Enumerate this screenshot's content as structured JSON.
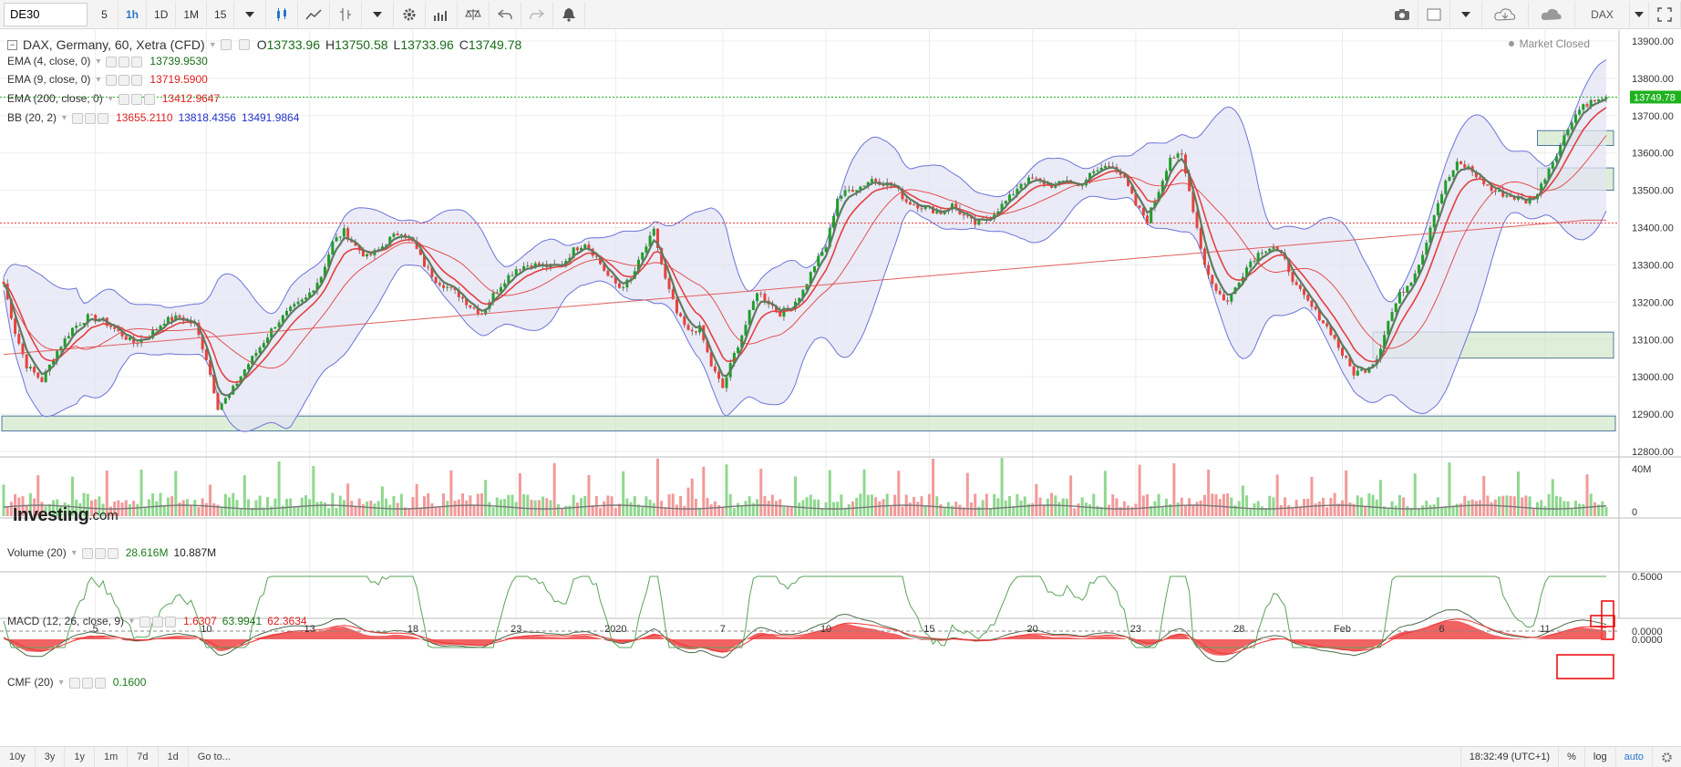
{
  "toolbar": {
    "symbol": "DE30",
    "intervals": [
      "5",
      "1h",
      "1D",
      "1M",
      "15"
    ],
    "active_interval": "1h",
    "right_symbol": "DAX",
    "icons": [
      "chart-type-icon",
      "line-icon",
      "bar-style-icon",
      "settings-icon",
      "indicators-icon",
      "compare-icon",
      "undo-icon",
      "redo-icon",
      "alert-icon",
      "camera-icon",
      "layout-icon",
      "cloud-load-icon",
      "cloud-save-icon",
      "fullscreen-icon"
    ]
  },
  "main_legend": {
    "title": "DAX, Germany, 60, Xetra (CFD)",
    "o_label": "O",
    "o": "13733.96",
    "h_label": "H",
    "h": "13750.58",
    "l_label": "L",
    "l": "13733.96",
    "c_label": "C",
    "c": "13749.78",
    "market_status": "Market Closed"
  },
  "indicators": [
    {
      "label": "EMA (4, close, 0)",
      "values": [
        "13739.9530"
      ],
      "colors": [
        "#1a7a1a"
      ]
    },
    {
      "label": "EMA (9, close, 0)",
      "values": [
        "13719.5900"
      ],
      "colors": [
        "#e02020"
      ]
    },
    {
      "label": "EMA (200, close, 0)",
      "values": [
        "13412.9647"
      ],
      "colors": [
        "#e02020"
      ]
    },
    {
      "label": "BB (20, 2)",
      "values": [
        "13655.2110",
        "13818.4356",
        "13491.9864"
      ],
      "colors": [
        "#e02020",
        "#2233cc",
        "#2233cc"
      ]
    }
  ],
  "volume_legend": {
    "label": "Volume (20)",
    "v1": "28.616M",
    "v2": "10.887M"
  },
  "macd_legend": {
    "label": "MACD (12, 26, close, 9)",
    "v1": "1.6307",
    "v2": "63.9941",
    "v3": "62.3634"
  },
  "cmf_legend": {
    "label": "CMF (20)",
    "v1": "0.1600"
  },
  "watermark": {
    "brand": "Investing",
    "suffix": ".com"
  },
  "price_axis": {
    "ticks": [
      "13900.00",
      "13800.00",
      "13700.00",
      "13600.00",
      "13500.00",
      "13400.00",
      "13300.00",
      "13200.00",
      "13100.00",
      "13000.00",
      "12900.00",
      "12800.00"
    ],
    "last_price": "13749.78"
  },
  "volume_axis": {
    "ticks": [
      "40M",
      "0"
    ]
  },
  "macd_axis": {
    "ticks": [
      "0.0000"
    ]
  },
  "cmf_axis": {
    "ticks": [
      "0.5000",
      "0.0000"
    ]
  },
  "x_axis": {
    "labels": [
      "5",
      "10",
      "13",
      "18",
      "23",
      "2020",
      "7",
      "10",
      "15",
      "20",
      "23",
      "28",
      "Feb",
      "6",
      "11"
    ]
  },
  "bottom_bar": {
    "ranges": [
      "10y",
      "3y",
      "1y",
      "1m",
      "7d",
      "1d"
    ],
    "goto": "Go to...",
    "time": "18:32:49 (UTC+1)",
    "pct": "%",
    "log": "log",
    "auto": "auto"
  },
  "colors": {
    "up": "#1e9e2a",
    "down": "#e8413c",
    "bb": "#6b74d9",
    "bb_fill": "#e3e4f3",
    "ema4": "#5e7a5e",
    "ema9": "#e34040",
    "ema200": "#e06060",
    "zone": "#c8e3c0",
    "accent": "#2a77c9"
  },
  "chart_data": {
    "type": "candlestick",
    "title": "DAX, Germany, 60, Xetra (CFD)",
    "x_labels": [
      "5",
      "10",
      "13",
      "18",
      "23",
      "2020",
      "7",
      "10",
      "15",
      "20",
      "23",
      "28",
      "Feb",
      "6",
      "11"
    ],
    "ylim": [
      12800,
      13900
    ],
    "close_path": [
      [
        0,
        13250
      ],
      [
        3,
        13120
      ],
      [
        6,
        13030
      ],
      [
        10,
        12990
      ],
      [
        14,
        13070
      ],
      [
        18,
        13130
      ],
      [
        22,
        13160
      ],
      [
        26,
        13150
      ],
      [
        30,
        13120
      ],
      [
        34,
        13090
      ],
      [
        38,
        13110
      ],
      [
        42,
        13150
      ],
      [
        46,
        13160
      ],
      [
        50,
        13140
      ],
      [
        53,
        13050
      ],
      [
        56,
        12920
      ],
      [
        59,
        12950
      ],
      [
        63,
        13020
      ],
      [
        67,
        13080
      ],
      [
        71,
        13140
      ],
      [
        75,
        13180
      ],
      [
        79,
        13210
      ],
      [
        83,
        13270
      ],
      [
        86,
        13360
      ],
      [
        89,
        13390
      ],
      [
        92,
        13350
      ],
      [
        95,
        13320
      ],
      [
        98,
        13340
      ],
      [
        101,
        13370
      ],
      [
        104,
        13390
      ],
      [
        107,
        13360
      ],
      [
        110,
        13300
      ],
      [
        113,
        13260
      ],
      [
        116,
        13240
      ],
      [
        119,
        13220
      ],
      [
        122,
        13190
      ],
      [
        125,
        13170
      ],
      [
        128,
        13220
      ],
      [
        131,
        13260
      ],
      [
        134,
        13290
      ],
      [
        137,
        13300
      ],
      [
        140,
        13300
      ],
      [
        143,
        13295
      ],
      [
        146,
        13300
      ],
      [
        149,
        13340
      ],
      [
        152,
        13360
      ],
      [
        155,
        13320
      ],
      [
        158,
        13270
      ],
      [
        161,
        13240
      ],
      [
        164,
        13260
      ],
      [
        167,
        13330
      ],
      [
        170,
        13390
      ],
      [
        173,
        13260
      ],
      [
        176,
        13170
      ],
      [
        179,
        13120
      ],
      [
        182,
        13130
      ],
      [
        185,
        13030
      ],
      [
        188,
        12970
      ],
      [
        191,
        13060
      ],
      [
        194,
        13140
      ],
      [
        197,
        13230
      ],
      [
        200,
        13200
      ],
      [
        203,
        13170
      ],
      [
        206,
        13190
      ],
      [
        209,
        13230
      ],
      [
        212,
        13300
      ],
      [
        215,
        13350
      ],
      [
        218,
        13480
      ],
      [
        221,
        13500
      ],
      [
        224,
        13510
      ],
      [
        227,
        13530
      ],
      [
        230,
        13520
      ],
      [
        233,
        13510
      ],
      [
        236,
        13470
      ],
      [
        239,
        13460
      ],
      [
        242,
        13450
      ],
      [
        245,
        13440
      ],
      [
        248,
        13460
      ],
      [
        251,
        13430
      ],
      [
        254,
        13410
      ],
      [
        257,
        13420
      ],
      [
        260,
        13450
      ],
      [
        263,
        13480
      ],
      [
        266,
        13520
      ],
      [
        269,
        13530
      ],
      [
        272,
        13520
      ],
      [
        275,
        13510
      ],
      [
        278,
        13530
      ],
      [
        281,
        13510
      ],
      [
        284,
        13540
      ],
      [
        287,
        13560
      ],
      [
        290,
        13570
      ],
      [
        293,
        13530
      ],
      [
        296,
        13460
      ],
      [
        299,
        13420
      ],
      [
        302,
        13500
      ],
      [
        305,
        13590
      ],
      [
        308,
        13590
      ],
      [
        311,
        13450
      ],
      [
        314,
        13300
      ],
      [
        317,
        13230
      ],
      [
        320,
        13200
      ],
      [
        323,
        13260
      ],
      [
        326,
        13310
      ],
      [
        329,
        13340
      ],
      [
        332,
        13350
      ],
      [
        335,
        13310
      ],
      [
        338,
        13240
      ],
      [
        341,
        13200
      ],
      [
        344,
        13160
      ],
      [
        347,
        13120
      ],
      [
        350,
        13060
      ],
      [
        353,
        13010
      ],
      [
        356,
        13020
      ],
      [
        359,
        13050
      ],
      [
        362,
        13150
      ],
      [
        365,
        13220
      ],
      [
        368,
        13260
      ],
      [
        371,
        13330
      ],
      [
        374,
        13440
      ],
      [
        377,
        13520
      ],
      [
        380,
        13570
      ],
      [
        383,
        13560
      ],
      [
        386,
        13530
      ],
      [
        389,
        13500
      ],
      [
        392,
        13490
      ],
      [
        395,
        13480
      ],
      [
        398,
        13470
      ],
      [
        401,
        13490
      ],
      [
        404,
        13560
      ],
      [
        407,
        13620
      ],
      [
        410,
        13690
      ],
      [
        413,
        13730
      ],
      [
        416,
        13740
      ]
    ],
    "series": [
      {
        "name": "EMA (4, close, 0)",
        "last": 13739.953
      },
      {
        "name": "EMA (9, close, 0)",
        "last": 13719.59
      },
      {
        "name": "EMA (200, close, 0)",
        "last": 13412.9647
      },
      {
        "name": "BB (20, 2)",
        "basis": 13655.211,
        "upper": 13818.4356,
        "lower": 13491.9864
      }
    ],
    "last_close": 13749.78,
    "support_zones": [
      [
        12855,
        12895
      ],
      [
        13050,
        13120
      ],
      [
        13500,
        13560
      ],
      [
        13620,
        13660
      ]
    ],
    "resistance_line": 13412,
    "volume_axis_max_label": "40M",
    "cmf_range": [
      -0.2,
      0.55
    ],
    "grid": true
  }
}
